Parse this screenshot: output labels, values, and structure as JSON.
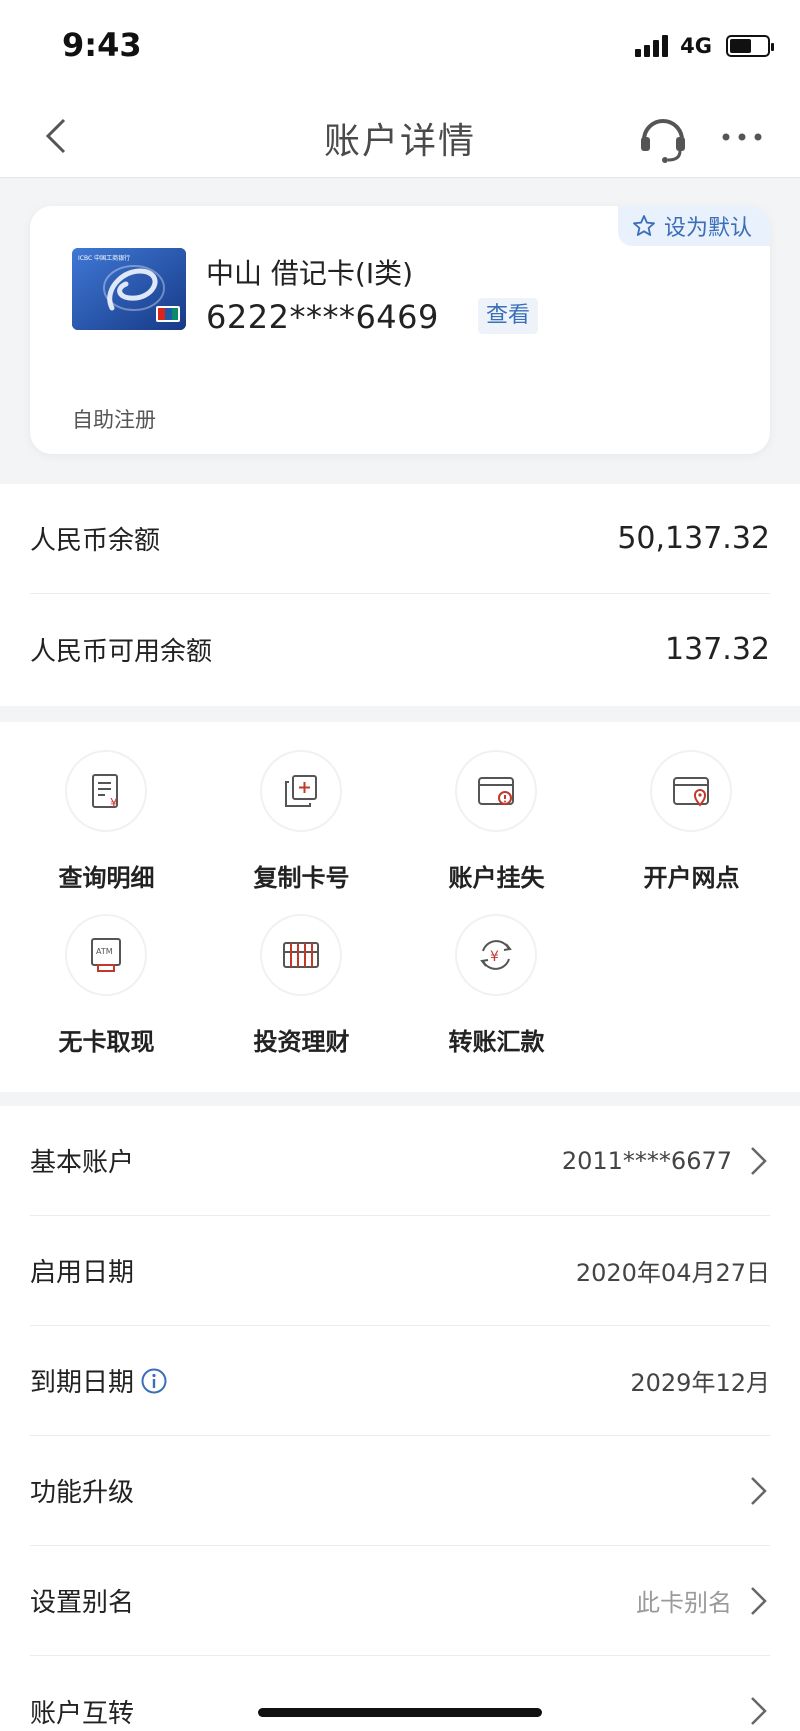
{
  "status_bar": {
    "time": "9:43",
    "network": "4G",
    "battery_level": 0.58
  },
  "nav": {
    "title": "账户详情",
    "back_icon": "chevron-left-icon",
    "service_icon": "headset-icon",
    "more_icon": "more-dots-icon"
  },
  "card": {
    "default_label": "设为默认",
    "name": "中山 借记卡(Ⅰ类)",
    "number": "6222****6469",
    "view_label": "查看",
    "registration": "自助注册",
    "bank_logo_text": "ICBC 中国工商银行"
  },
  "balances": [
    {
      "label": "人民币余额",
      "value": "50,137.32"
    },
    {
      "label": "人民币可用余额",
      "value": "137.32"
    }
  ],
  "actions": [
    {
      "label": "查询明细",
      "icon": "statement-icon"
    },
    {
      "label": "复制卡号",
      "icon": "copy-icon"
    },
    {
      "label": "账户挂失",
      "icon": "card-alert-icon"
    },
    {
      "label": "开户网点",
      "icon": "card-location-icon"
    },
    {
      "label": "无卡取现",
      "icon": "atm-icon"
    },
    {
      "label": "投资理财",
      "icon": "abacus-icon"
    },
    {
      "label": "转账汇款",
      "icon": "transfer-icon"
    }
  ],
  "info": [
    {
      "label": "基本账户",
      "value": "2011****6677",
      "chevron": true
    },
    {
      "label": "启用日期",
      "value": "2020年04月27日",
      "chevron": false
    },
    {
      "label": "到期日期",
      "value": "2029年12月",
      "chevron": false,
      "info_icon": true
    },
    {
      "label": "功能升级",
      "value": "",
      "chevron": true
    },
    {
      "label": "设置别名",
      "value": "此卡别名",
      "chevron": true,
      "muted": true
    },
    {
      "label": "账户互转",
      "value": "",
      "chevron": true
    }
  ],
  "colors": {
    "accent": "#3a6fb8",
    "icon_red": "#c0392b",
    "icon_dark": "#555555"
  }
}
